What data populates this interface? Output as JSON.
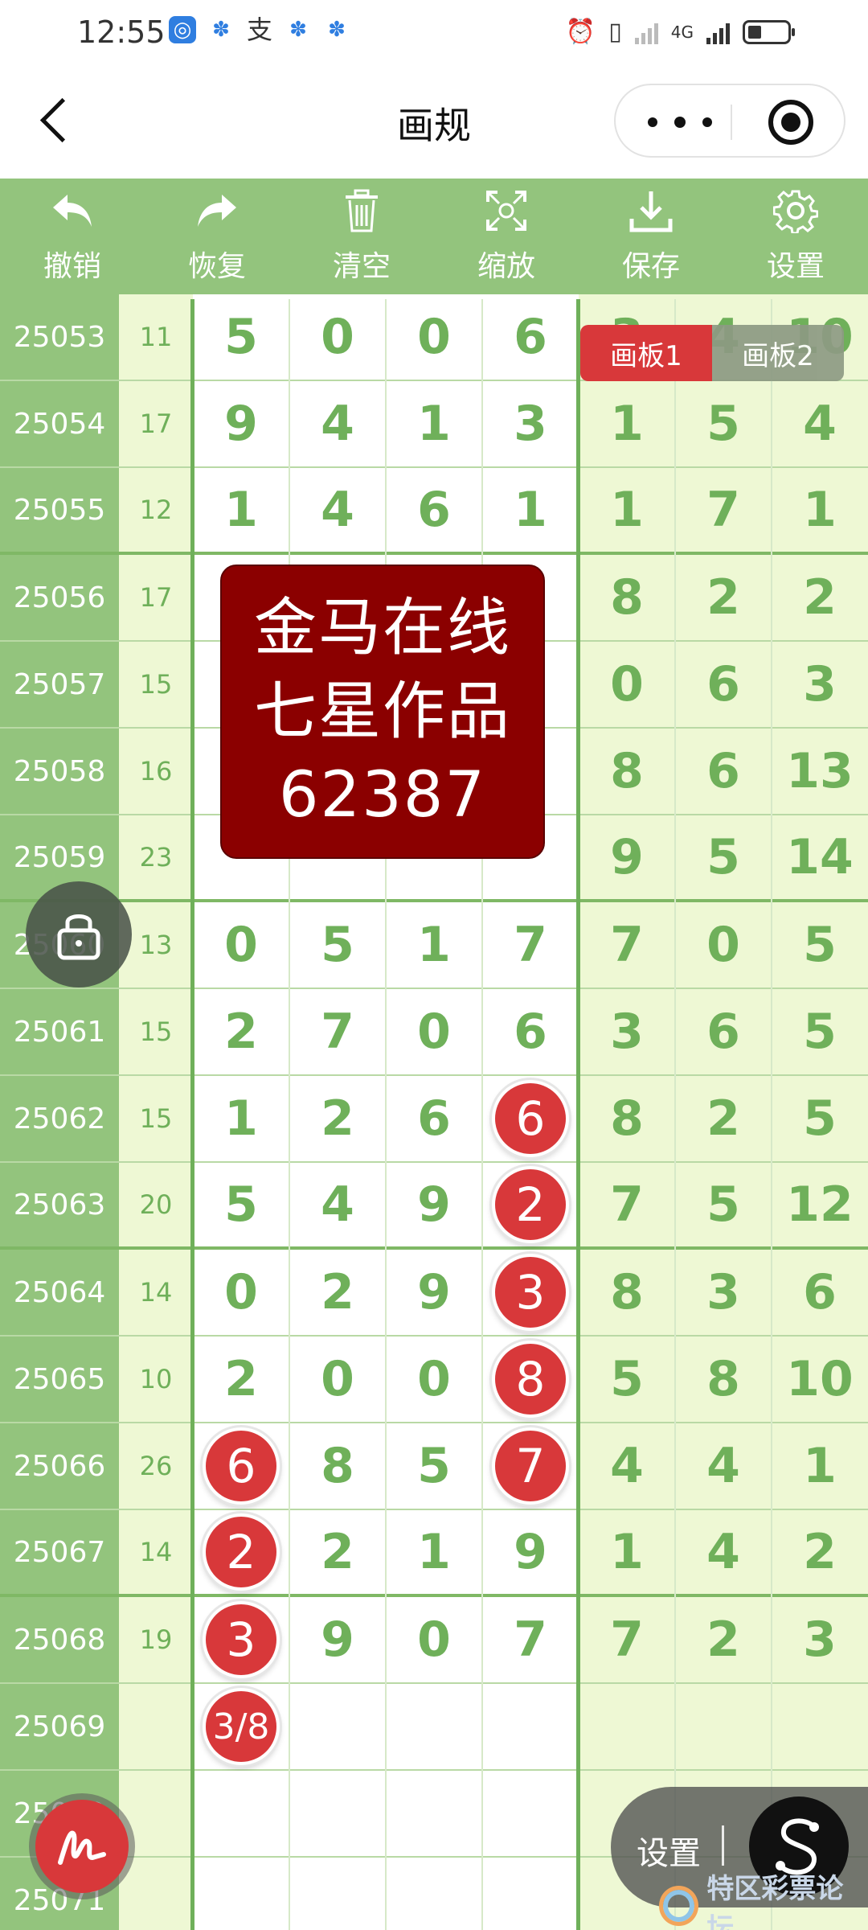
{
  "status_bar": {
    "time": "12:55",
    "net_label": "4G"
  },
  "nav": {
    "title": "画规"
  },
  "toolbar": [
    {
      "label": "撤销",
      "icon": "undo-icon"
    },
    {
      "label": "恢复",
      "icon": "redo-icon"
    },
    {
      "label": "清空",
      "icon": "trash-icon"
    },
    {
      "label": "缩放",
      "icon": "zoom-icon"
    },
    {
      "label": "保存",
      "icon": "download-icon"
    },
    {
      "label": "设置",
      "icon": "gear-icon"
    }
  ],
  "board_tabs": [
    {
      "label": "画板1",
      "active": true
    },
    {
      "label": "画板2",
      "active": false
    }
  ],
  "watermark": [
    "金马在线",
    "七星作品",
    "62387"
  ],
  "rows": [
    {
      "id": "25053",
      "sum": "11",
      "d": [
        "5",
        "0",
        "0",
        "6"
      ],
      "s": [
        "3",
        "4",
        "10"
      ]
    },
    {
      "id": "25054",
      "sum": "17",
      "d": [
        "9",
        "4",
        "1",
        "3"
      ],
      "s": [
        "1",
        "5",
        "4"
      ]
    },
    {
      "id": "25055",
      "sum": "12",
      "d": [
        "1",
        "4",
        "6",
        "1"
      ],
      "s": [
        "1",
        "7",
        "1"
      ]
    },
    {
      "id": "25056",
      "sum": "17",
      "d": [
        "",
        "",
        "",
        ""
      ],
      "s": [
        "8",
        "2",
        "2"
      ]
    },
    {
      "id": "25057",
      "sum": "15",
      "d": [
        "",
        "",
        "",
        ""
      ],
      "s": [
        "0",
        "6",
        "3"
      ]
    },
    {
      "id": "25058",
      "sum": "16",
      "d": [
        "",
        "",
        "",
        ""
      ],
      "s": [
        "8",
        "6",
        "13"
      ]
    },
    {
      "id": "25059",
      "sum": "23",
      "d": [
        "",
        "",
        "",
        ""
      ],
      "s": [
        "9",
        "5",
        "14"
      ]
    },
    {
      "id": "25060",
      "sum": "13",
      "d": [
        "0",
        "5",
        "1",
        "7"
      ],
      "s": [
        "7",
        "0",
        "5"
      ]
    },
    {
      "id": "25061",
      "sum": "15",
      "d": [
        "2",
        "7",
        "0",
        "6"
      ],
      "s": [
        "3",
        "6",
        "5"
      ]
    },
    {
      "id": "25062",
      "sum": "15",
      "d": [
        "1",
        "2",
        "6",
        "6"
      ],
      "s": [
        "8",
        "2",
        "5"
      ]
    },
    {
      "id": "25063",
      "sum": "20",
      "d": [
        "5",
        "4",
        "9",
        "2"
      ],
      "s": [
        "7",
        "5",
        "12"
      ]
    },
    {
      "id": "25064",
      "sum": "14",
      "d": [
        "0",
        "2",
        "9",
        "3"
      ],
      "s": [
        "8",
        "3",
        "6"
      ]
    },
    {
      "id": "25065",
      "sum": "10",
      "d": [
        "2",
        "0",
        "0",
        "8"
      ],
      "s": [
        "5",
        "8",
        "10"
      ]
    },
    {
      "id": "25066",
      "sum": "26",
      "d": [
        "6",
        "8",
        "5",
        "7"
      ],
      "s": [
        "4",
        "4",
        "1"
      ]
    },
    {
      "id": "25067",
      "sum": "14",
      "d": [
        "2",
        "2",
        "1",
        "9"
      ],
      "s": [
        "1",
        "4",
        "2"
      ]
    },
    {
      "id": "25068",
      "sum": "19",
      "d": [
        "3",
        "9",
        "0",
        "7"
      ],
      "s": [
        "7",
        "2",
        "3"
      ]
    },
    {
      "id": "25069",
      "sum": "",
      "d": [
        "3/8",
        "",
        "",
        ""
      ],
      "s": [
        "",
        "",
        ""
      ]
    },
    {
      "id": "25070",
      "sum": "",
      "d": [
        "",
        "",
        "",
        ""
      ],
      "s": [
        "",
        "",
        ""
      ]
    },
    {
      "id": "25071",
      "sum": "",
      "d": [
        "",
        "",
        "",
        ""
      ],
      "s": [
        "",
        "",
        ""
      ]
    }
  ],
  "highlights": [
    {
      "row": 9,
      "col": 3
    },
    {
      "row": 10,
      "col": 3
    },
    {
      "row": 11,
      "col": 3
    },
    {
      "row": 12,
      "col": 3
    },
    {
      "row": 13,
      "col": 3
    },
    {
      "row": 13,
      "col": 0
    },
    {
      "row": 14,
      "col": 0
    },
    {
      "row": 15,
      "col": 0
    },
    {
      "row": 16,
      "col": 0
    }
  ],
  "float_settings": {
    "label": "设置"
  },
  "footer": {
    "text": "特区彩票论坛"
  },
  "colors": {
    "toolbar": "#93c47d",
    "digit": "#6fb05a",
    "ball": "#d8383a",
    "side_bg": "#eef8d4",
    "watermark_bg": "#8b0000"
  }
}
